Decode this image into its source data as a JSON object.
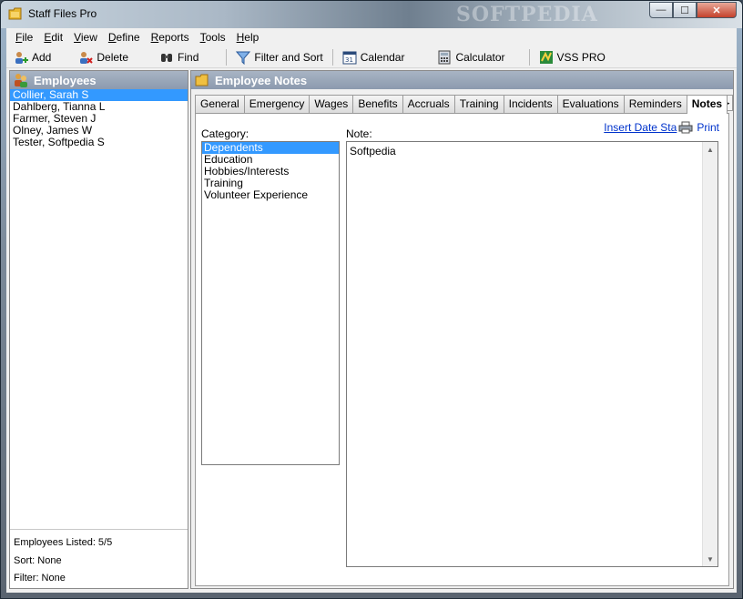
{
  "window": {
    "title": "Staff Files Pro",
    "watermark": "SOFTPEDIA",
    "controls": {
      "minimize": "—",
      "maximize": "☐",
      "close": "✕"
    }
  },
  "menu": [
    {
      "label": "File",
      "accel": "F",
      "rest": "ile"
    },
    {
      "label": "Edit",
      "accel": "E",
      "rest": "dit"
    },
    {
      "label": "View",
      "accel": "V",
      "rest": "iew"
    },
    {
      "label": "Define",
      "accel": "D",
      "rest": "efine"
    },
    {
      "label": "Reports",
      "accel": "R",
      "rest": "eports"
    },
    {
      "label": "Tools",
      "accel": "T",
      "rest": "ools"
    },
    {
      "label": "Help",
      "accel": "H",
      "rest": "elp"
    }
  ],
  "toolbar": {
    "add": "Add",
    "delete": "Delete",
    "find": "Find",
    "filter_sort": "Filter and Sort",
    "calendar": "Calendar",
    "calculator": "Calculator",
    "vss_pro": "VSS PRO"
  },
  "employees": {
    "header": "Employees",
    "items": [
      {
        "name": "Collier, Sarah S",
        "selected": true
      },
      {
        "name": "Dahlberg, Tianna L",
        "selected": false
      },
      {
        "name": "Farmer, Steven J",
        "selected": false
      },
      {
        "name": "Olney, James W",
        "selected": false
      },
      {
        "name": "Tester, Softpedia S",
        "selected": false
      }
    ],
    "listed": "Employees Listed: 5/5",
    "sort": "Sort: None",
    "filter": "Filter: None"
  },
  "notes_panel": {
    "header": "Employee Notes",
    "tabs": [
      {
        "label": "General",
        "active": false
      },
      {
        "label": "Emergency",
        "active": false
      },
      {
        "label": "Wages",
        "active": false
      },
      {
        "label": "Benefits",
        "active": false
      },
      {
        "label": "Accruals",
        "active": false
      },
      {
        "label": "Training",
        "active": false
      },
      {
        "label": "Incidents",
        "active": false
      },
      {
        "label": "Evaluations",
        "active": false
      },
      {
        "label": "Reminders",
        "active": false
      },
      {
        "label": "Notes",
        "active": true
      }
    ],
    "insert_date_stamp": "Insert Date Sta",
    "print": "Print",
    "category_label": "Category:",
    "note_label": "Note:",
    "categories": [
      {
        "label": "Dependents",
        "selected": true
      },
      {
        "label": "Education",
        "selected": false
      },
      {
        "label": "Hobbies/Interests",
        "selected": false
      },
      {
        "label": "Training",
        "selected": false
      },
      {
        "label": "Volunteer Experience",
        "selected": false
      }
    ],
    "note_text": "Softpedia"
  }
}
